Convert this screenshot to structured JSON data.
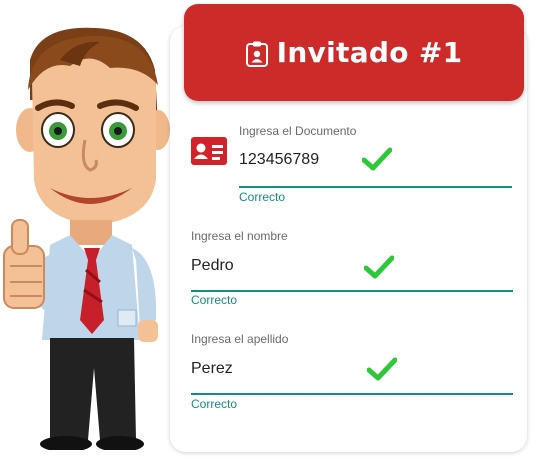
{
  "header": {
    "title": "Invitado #1",
    "icon": "id-badge-icon",
    "color": "#cd2a2a"
  },
  "accent_color": "#148d82",
  "check_color": "#2ec93b",
  "fields": [
    {
      "label": "Ingresa el Documento",
      "value": "123456789",
      "helper": "Correcto",
      "icon": "id-card-icon",
      "valid": true
    },
    {
      "label": "Ingresa el nombre",
      "value": "Pedro",
      "helper": "Correcto",
      "valid": true
    },
    {
      "label": "Ingresa el apellido",
      "value": "Perez",
      "helper": "Correcto",
      "valid": true
    }
  ]
}
